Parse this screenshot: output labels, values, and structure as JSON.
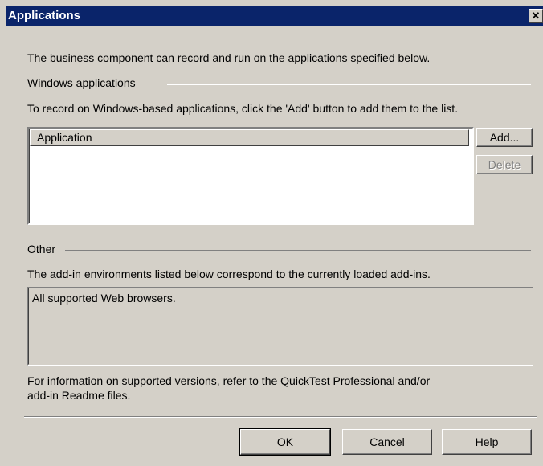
{
  "window": {
    "title": "Applications",
    "close_glyph": "✕"
  },
  "intro_text": "The business component can record and run on the applications specified below.",
  "windows_group": {
    "label": "Windows applications",
    "instructions": "To record on Windows-based applications, click the 'Add' button to add them to the list.",
    "list": {
      "columns": [
        "Application"
      ],
      "rows": []
    },
    "add_label": "Add...",
    "delete_label": "Delete"
  },
  "other_group": {
    "label": "Other",
    "description": "The add-in environments listed below correspond to the currently loaded add-ins.",
    "items": [
      "All supported Web browsers."
    ]
  },
  "footer_note": {
    "line1": "For information on supported versions, refer to the QuickTest Professional and/or",
    "line2": "add-in Readme files."
  },
  "buttons": {
    "ok": "OK",
    "cancel": "Cancel",
    "help": "Help"
  }
}
